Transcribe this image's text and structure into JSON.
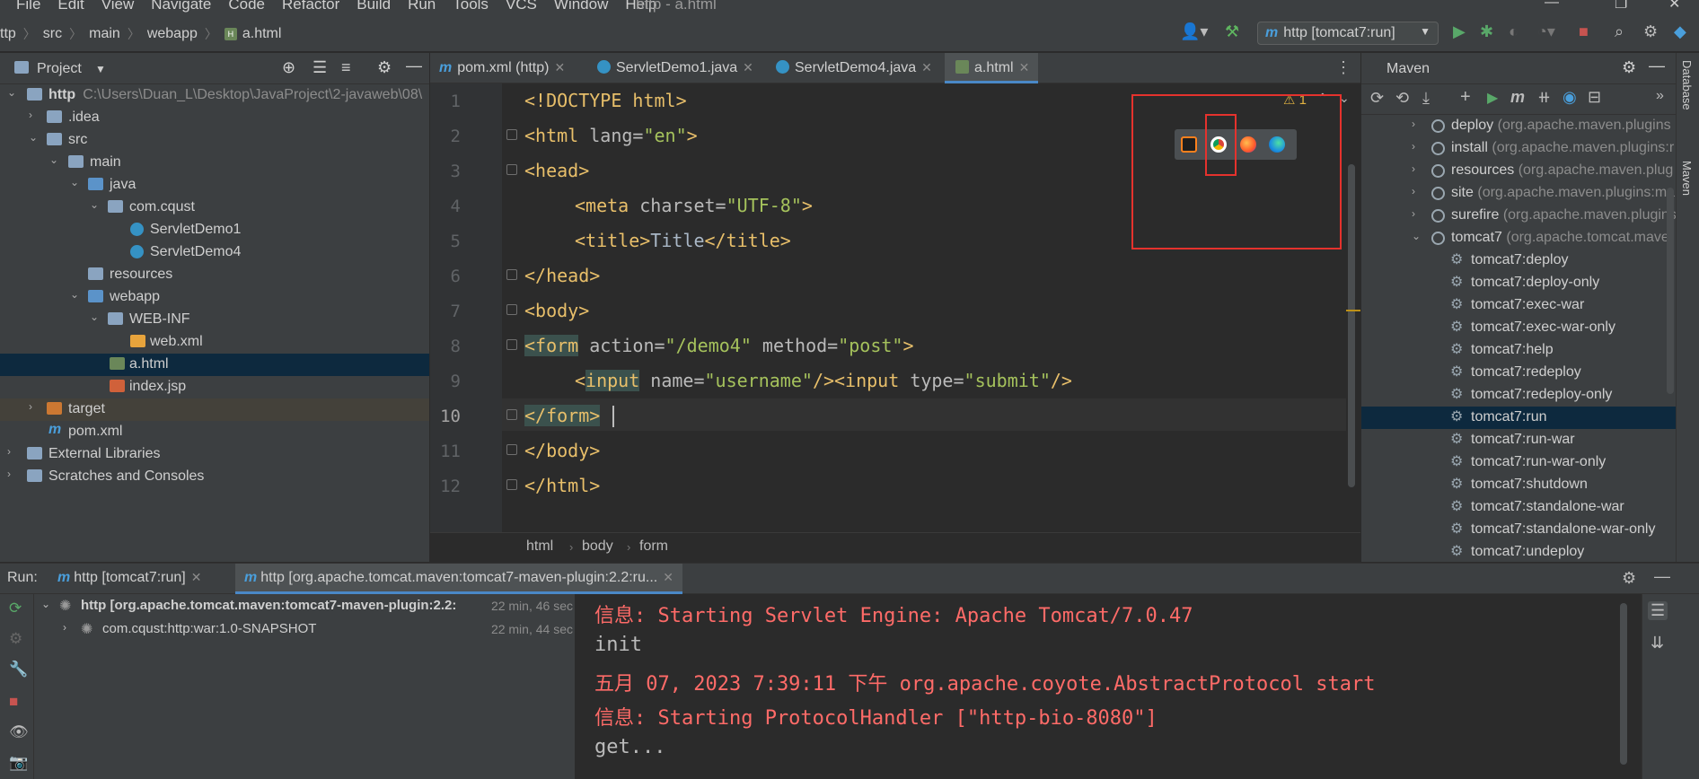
{
  "menu": [
    "File",
    "Edit",
    "View",
    "Navigate",
    "Code",
    "Refactor",
    "Build",
    "Run",
    "Tools",
    "VCS",
    "Window",
    "Help"
  ],
  "window_title": "http - a.html",
  "nav": {
    "crumbs": [
      "ttp",
      "src",
      "main",
      "webapp",
      "a.html"
    ],
    "run_config": "http [tomcat7:run]"
  },
  "project": {
    "title": "Project",
    "root_name": "http",
    "root_path": "C:\\Users\\Duan_L\\Desktop\\JavaProject\\2-javaweb\\08\\",
    "items": [
      ".idea",
      "src",
      "main",
      "java",
      "com.cqust",
      "ServletDemo1",
      "ServletDemo4",
      "resources",
      "webapp",
      "WEB-INF",
      "web.xml",
      "a.html",
      "index.jsp",
      "target",
      "pom.xml",
      "External Libraries",
      "Scratches and Consoles"
    ]
  },
  "editor": {
    "tabs": [
      "pom.xml (http)",
      "ServletDemo1.java",
      "ServletDemo4.java",
      "a.html"
    ],
    "active_tab": "a.html",
    "lines": [
      "1",
      "2",
      "3",
      "4",
      "5",
      "6",
      "7",
      "8",
      "9",
      "10",
      "11",
      "12"
    ],
    "current_line": 10,
    "warning_count": "1",
    "breadcrumb": [
      "html",
      "body",
      "form"
    ],
    "code": {
      "l1": "<!DOCTYPE html>",
      "l2_tag": "<html ",
      "l2_attr": "lang=",
      "l2_val": "\"en\"",
      "l2_end": ">",
      "l3": "<head>",
      "l4_tag": "<meta ",
      "l4_attr": "charset=",
      "l4_val": "\"UTF-8\"",
      "l4_end": ">",
      "l5_open": "<title>",
      "l5_text": "Title",
      "l5_close": "</title>",
      "l6": "</head>",
      "l7": "<body>",
      "l8_tag": "<form",
      "l8_attr1": " action=",
      "l8_val1": "\"/demo4\"",
      "l8_attr2": " method=",
      "l8_val2": "\"post\"",
      "l8_end": ">",
      "l9_lt": "<",
      "l9_tag": "input",
      "l9_attr": " name=",
      "l9_val": "\"username\"",
      "l9_mid": "/><input ",
      "l9_attr2": "type=",
      "l9_val2": "\"submit\"",
      "l9_end": "/>",
      "l10": "</form>",
      "l11": "</body>",
      "l12": "</html>"
    }
  },
  "maven": {
    "title": "Maven",
    "plugins": [
      {
        "name": "deploy",
        "group": "(org.apache.maven.plugins"
      },
      {
        "name": "install",
        "group": "(org.apache.maven.plugins:r"
      },
      {
        "name": "resources",
        "group": "(org.apache.maven.plug"
      },
      {
        "name": "site",
        "group": "(org.apache.maven.plugins:ma"
      },
      {
        "name": "surefire",
        "group": "(org.apache.maven.plugins"
      },
      {
        "name": "tomcat7",
        "group": "(org.apache.tomcat.mave"
      }
    ],
    "goals": [
      "tomcat7:deploy",
      "tomcat7:deploy-only",
      "tomcat7:exec-war",
      "tomcat7:exec-war-only",
      "tomcat7:help",
      "tomcat7:redeploy",
      "tomcat7:redeploy-only",
      "tomcat7:run",
      "tomcat7:run-war",
      "tomcat7:run-war-only",
      "tomcat7:shutdown",
      "tomcat7:standalone-war",
      "tomcat7:standalone-war-only",
      "tomcat7:undeploy"
    ],
    "selected_goal": "tomcat7:run",
    "side_labels": [
      "Database",
      "Maven"
    ]
  },
  "run": {
    "label": "Run:",
    "tabs": [
      "http [tomcat7:run]",
      "http [org.apache.tomcat.maven:tomcat7-maven-plugin:2.2:ru..."
    ],
    "tree": [
      {
        "label": "http [org.apache.tomcat.maven:tomcat7-maven-plugin:2.2:",
        "time": "22 min, 46 sec"
      },
      {
        "label": "com.cqust:http:war:1.0-SNAPSHOT",
        "time": "22 min, 44 sec"
      }
    ],
    "console": [
      {
        "text": "信息: Starting Servlet Engine: Apache Tomcat/7.0.47",
        "kind": "err"
      },
      {
        "text": "init",
        "kind": "out"
      },
      {
        "text": "五月 07, 2023 7:39:11 下午 org.apache.coyote.AbstractProtocol start",
        "kind": "err"
      },
      {
        "text": "信息: Starting ProtocolHandler [\"http-bio-8080\"]",
        "kind": "err"
      },
      {
        "text": "get...",
        "kind": "out"
      }
    ]
  },
  "colors": {
    "accent": "#4a88c7",
    "highlight_box": "#e5322d",
    "error_text": "#ff6b68",
    "tag": "#e8bf6a",
    "string": "#a5c25c"
  }
}
